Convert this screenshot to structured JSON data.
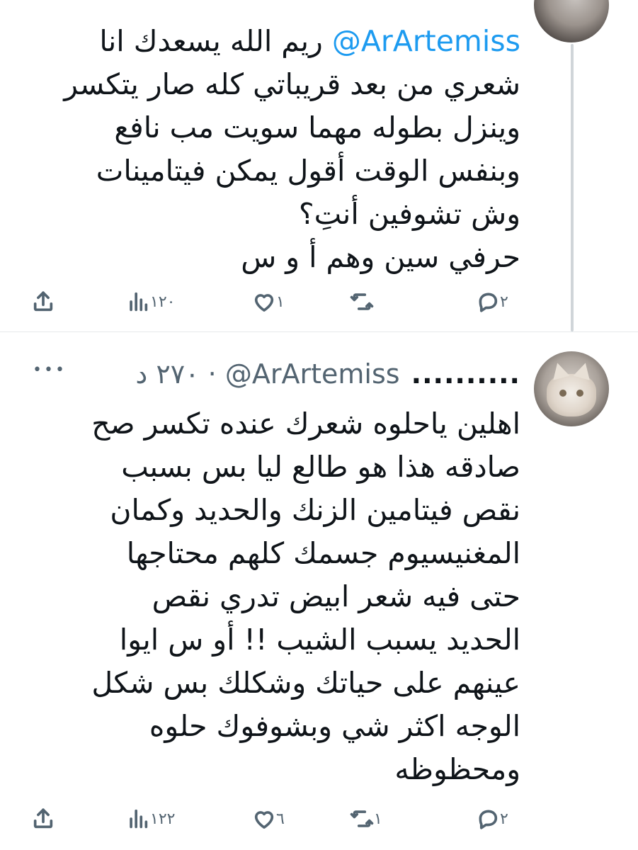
{
  "tweets": [
    {
      "mention": "@ArArtemiss",
      "text_after_mention": " ريم الله يسعدك انا\nشعري من بعد قريباتي كله صار يتكسر\nوينزل بطوله مهما سويت مب نافع\nوبنفس الوقت أقول يمكن فيتامينات\nوش تشوفين أنتِ؟\nحرفي سين وهم أ و س",
      "replies": "٢",
      "retweets": "",
      "likes": "١",
      "views": "١٢٠",
      "avatar_icon": "user-avatar-dark"
    },
    {
      "display_name": "..........",
      "handle": "@ArArtemiss",
      "time": "٢٧٠ د",
      "separator": "·",
      "text": "اهلين ياحلوه شعرك عنده تكسر صح\nصادقه هذا هو طالع ليا بس بسبب\nنقص فيتامين الزنك والحديد وكمان\nالمغنيسيوم جسمك كلهم محتاجها\nحتى فيه شعر ابيض تدري نقص\nالحديد يسبب الشيب !! أو س ايوا\nعينهم على حياتك وشكلك بس شكل\nالوجه اكثر شي وبشوفوك حلوه\nومحظوظه",
      "replies": "٢",
      "retweets": "١",
      "likes": "٦",
      "views": "١٢٢",
      "avatar_icon": "cat-avatar"
    }
  ],
  "icons": {
    "reply": "reply-icon",
    "retweet": "retweet-icon",
    "like": "heart-icon",
    "views": "views-icon",
    "share": "share-icon",
    "more": "more-icon"
  },
  "colors": {
    "mention": "#1d9bf0",
    "text": "#0f1419",
    "muted": "#536471"
  }
}
